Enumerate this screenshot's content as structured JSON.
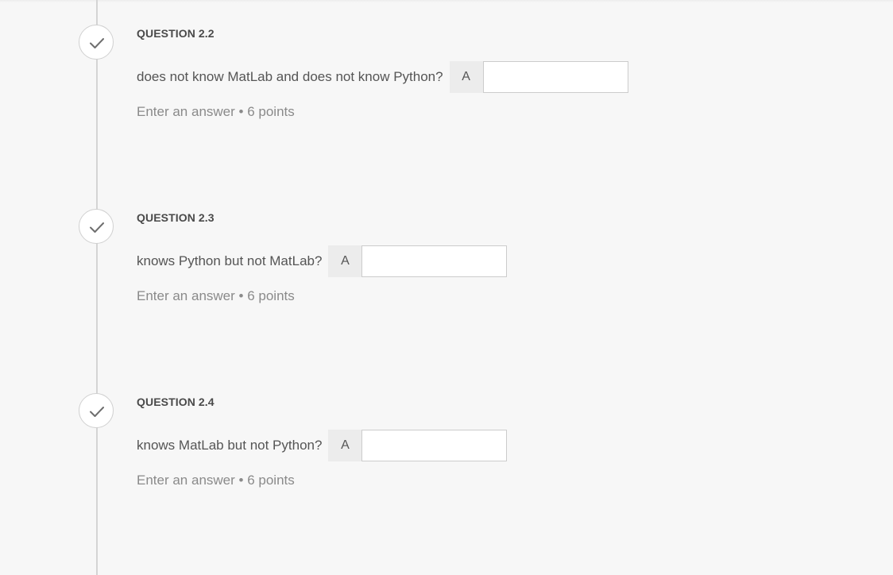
{
  "questions": [
    {
      "label": "QUESTION 2.2",
      "text": "does not know MatLab and does not know Python?",
      "prefix": "A",
      "value": "",
      "hint": "Enter an answer",
      "separator": "•",
      "points": "6 points"
    },
    {
      "label": "QUESTION 2.3",
      "text": "knows Python but not MatLab?",
      "prefix": "A",
      "value": "",
      "hint": "Enter an answer",
      "separator": "•",
      "points": "6 points"
    },
    {
      "label": "QUESTION 2.4",
      "text": "knows MatLab but not Python?",
      "prefix": "A",
      "value": "",
      "hint": "Enter an answer",
      "separator": "•",
      "points": "6 points"
    }
  ],
  "icons": {
    "status": "checkmark-icon"
  },
  "colors": {
    "background": "#f7f7f7",
    "timeline": "#d4d4d4",
    "check": "#6e6e6e",
    "text": "#555555",
    "muted": "#8a8a8a"
  }
}
